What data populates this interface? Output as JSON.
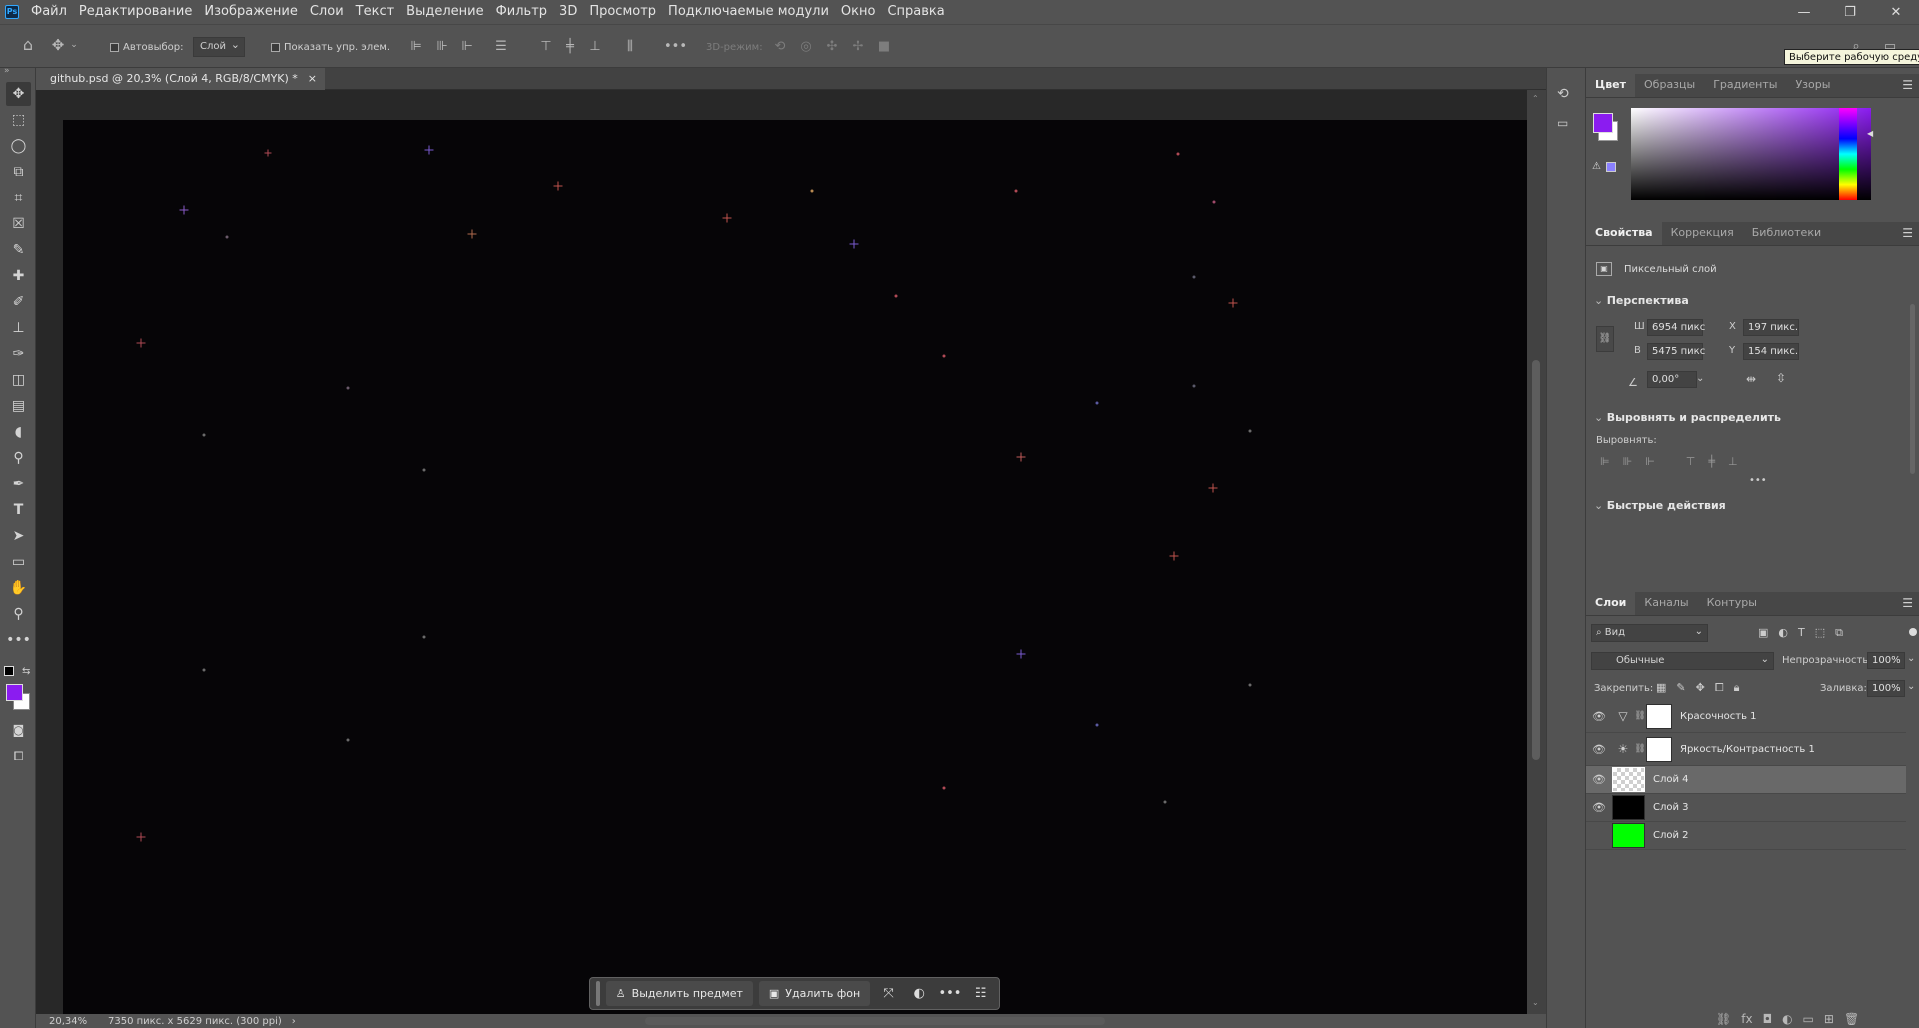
{
  "app": {
    "logo": "Ps"
  },
  "menu": [
    "Файл",
    "Редактирование",
    "Изображение",
    "Слои",
    "Текст",
    "Выделение",
    "Фильтр",
    "3D",
    "Просмотр",
    "Подключаемые модули",
    "Окно",
    "Справка"
  ],
  "window_controls": {
    "minimize": "—",
    "maximize": "❐",
    "close": "✕"
  },
  "options": {
    "autoselect_label": "Автовыбор:",
    "autoselect_value": "Слой",
    "show_transform_label": "Показать упр. элем.",
    "mode_3d_label": "3D-режим:",
    "more": "•••"
  },
  "tooltip": "Выберите рабочую среду",
  "document": {
    "tab_title": "github.psd @ 20,3% (Слой 4, RGB/8/CMYK) *",
    "close": "×"
  },
  "status": {
    "zoom": "20,34%",
    "doc_info": "7350 пикс. x 5629 пикс. (300 ppi)",
    "arrow": "›"
  },
  "context_bar": {
    "select_subject": "Выделить предмет",
    "remove_bg": "Удалить фон"
  },
  "color_panel": {
    "tabs": [
      "Цвет",
      "Образцы",
      "Градиенты",
      "Узоры"
    ],
    "foreground": "#8b1cf0",
    "background": "#ffffff"
  },
  "properties_panel": {
    "tabs": [
      "Свойства",
      "Коррекция",
      "Библиотеки"
    ],
    "layer_type": "Пиксельный слой",
    "transform_section": "Перспектива",
    "w_label": "Ш",
    "w_value": "6954 пикс",
    "h_label": "В",
    "h_value": "5475 пикс",
    "x_label": "X",
    "x_value": "197 пикс.",
    "y_label": "Y",
    "y_value": "154 пикс.",
    "angle_value": "0,00°",
    "align_section": "Выровнять и распределить",
    "align_label": "Выровнять:",
    "more": "•••",
    "quick_actions": "Быстрые действия"
  },
  "layers_panel": {
    "tabs": [
      "Слои",
      "Каналы",
      "Контуры"
    ],
    "filter_label": "Вид",
    "blend_mode": "Обычные",
    "opacity_label": "Непрозрачность:",
    "opacity_value": "100%",
    "lock_label": "Закрепить:",
    "fill_label": "Заливка:",
    "fill_value": "100%",
    "layers": [
      {
        "name": "Красочность 1",
        "type": "adjustment",
        "visible": true,
        "adj_icon": "▽"
      },
      {
        "name": "Яркость/Контрастность 1",
        "type": "adjustment",
        "visible": true,
        "adj_icon": "☀"
      },
      {
        "name": "Слой 4",
        "type": "pixel",
        "visible": true,
        "selected": true,
        "thumb": "transparent"
      },
      {
        "name": "Слой 3",
        "type": "pixel",
        "visible": true,
        "thumb": "#000000"
      },
      {
        "name": "Слой 2",
        "type": "pixel",
        "visible": false,
        "thumb": "#00ff00"
      }
    ]
  }
}
